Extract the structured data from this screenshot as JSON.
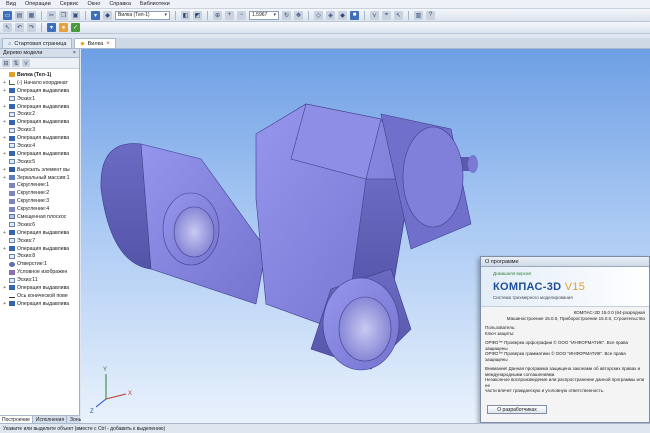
{
  "menu": [
    "Вид",
    "Операции",
    "Сервис",
    "Окно",
    "Справка",
    "Библиотеки"
  ],
  "toolbar": {
    "style_combo": "Вилка (Тел-1)",
    "zoom_value": "1.5967",
    "zoom_prefix": "▾"
  },
  "tabs": [
    {
      "label": "Стартовая страница",
      "active": false
    },
    {
      "label": "Вилка",
      "active": true
    }
  ],
  "tree_panel": {
    "title": "Дерево модели",
    "items": [
      {
        "label": "Вилка (Тел-1)",
        "icon": "model",
        "exp": "",
        "root": true
      },
      {
        "label": "(-) Начало координат",
        "icon": "origin",
        "exp": "+"
      },
      {
        "label": "Операция выдавлива",
        "icon": "op",
        "exp": "+"
      },
      {
        "label": "Эскиз:1",
        "icon": "sketch",
        "exp": ""
      },
      {
        "label": "Операция выдавлива",
        "icon": "op",
        "exp": "+"
      },
      {
        "label": "Эскиз:2",
        "icon": "sketch",
        "exp": ""
      },
      {
        "label": "Операция выдавлива",
        "icon": "op",
        "exp": "+"
      },
      {
        "label": "Эскиз:3",
        "icon": "sketch",
        "exp": ""
      },
      {
        "label": "Операция выдавлива",
        "icon": "op",
        "exp": "+"
      },
      {
        "label": "Эскиз:4",
        "icon": "sketch",
        "exp": ""
      },
      {
        "label": "Операция выдавлива",
        "icon": "op",
        "exp": "+"
      },
      {
        "label": "Эскиз:5",
        "icon": "sketch",
        "exp": ""
      },
      {
        "label": "Вырезать элемент вы",
        "icon": "cut",
        "exp": "+"
      },
      {
        "label": "Зеркальный массив:1",
        "icon": "mirror",
        "exp": "+"
      },
      {
        "label": "Скругление:1",
        "icon": "fillet",
        "exp": ""
      },
      {
        "label": "Скругление:2",
        "icon": "fillet",
        "exp": ""
      },
      {
        "label": "Скругление:3",
        "icon": "fillet",
        "exp": ""
      },
      {
        "label": "Скругление:4",
        "icon": "fillet",
        "exp": ""
      },
      {
        "label": "Смещенная плоскос",
        "icon": "plane",
        "exp": ""
      },
      {
        "label": "Эскиз:6",
        "icon": "sketch",
        "exp": ""
      },
      {
        "label": "Операция выдавлива",
        "icon": "op",
        "exp": "+"
      },
      {
        "label": "Эскиз:7",
        "icon": "sketch",
        "exp": ""
      },
      {
        "label": "Операция выдавлива",
        "icon": "op",
        "exp": "+"
      },
      {
        "label": "Эскиз:8",
        "icon": "sketch",
        "exp": ""
      },
      {
        "label": "Отверстие:1",
        "icon": "hole",
        "exp": ""
      },
      {
        "label": "Условное изображен",
        "icon": "cond",
        "exp": ""
      },
      {
        "label": "Эскиз:11",
        "icon": "sketch",
        "exp": ""
      },
      {
        "label": "Операция выдавлива",
        "icon": "op",
        "exp": "+"
      },
      {
        "label": "Ось конической пове",
        "icon": "axis",
        "exp": ""
      },
      {
        "label": "Операция выдавлива",
        "icon": "op",
        "exp": "+"
      }
    ],
    "bottom_tabs": [
      "Построение",
      "Исполнения",
      "Зоны"
    ]
  },
  "viewport": {
    "bg_top": "#6e9fe4",
    "bg_bottom": "#e9f2fc",
    "part_color": "#7f7fd8",
    "triad": {
      "x_label": "X",
      "y_label": "Y",
      "z_label": "Z"
    }
  },
  "about_dialog": {
    "title": "О программе",
    "version_badge": "Домашняя версия",
    "brand": "КОМПАС-3D",
    "brand_version": "V15",
    "brand_sub": "Система трехмерного моделирования",
    "lines": [
      "КОМПАС-3D 15.0.0 (64-разрядная",
      "Машиностроение 15.0.0, Приборостроение 15.0.0, Строительство",
      "",
      "Пользователь:",
      "Ключ защиты:",
      "",
      "ОРФО™ Проверка орфографии © ООО \"ИНФОРМАТИК\". Все права защищены",
      "ОРФО™ Проверка грамматики © ООО \"ИНФОРМАТИК\". Все права защищены",
      "",
      "Внимание! Данная программа защищена законами об авторских правах и",
      "международными соглашениями.",
      "Незаконное воспроизведение или распространение данной программы или ее",
      "части влечет гражданскую и уголовную ответственность."
    ],
    "button_label": "О разработчиках"
  },
  "status": "Укажите или выделите объект (вместе с Ctrl - добавить к выделению)"
}
